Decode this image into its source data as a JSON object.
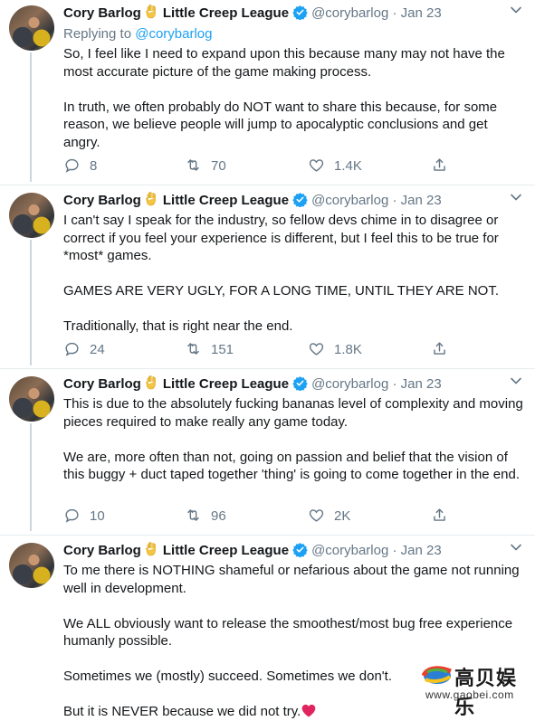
{
  "author": {
    "name": "Cory Barlog",
    "org": "Little Creep League",
    "handle": "@corybarlog",
    "date": "Jan 23"
  },
  "tweets": [
    {
      "reply_to_label": "Replying to",
      "reply_to_handle": "@corybarlog",
      "paragraphs": [
        "So, I feel like I need to expand upon this because many may not have the most accurate picture of the game making process.",
        "In truth, we often probably do NOT want to share this because, for some reason, we believe people will jump to apocalyptic conclusions and get angry."
      ],
      "replies": "8",
      "retweets": "70",
      "likes": "1.4K"
    },
    {
      "paragraphs": [
        "I can't say I speak for the industry, so fellow devs chime in to disagree or correct if you feel your experience is different, but I feel this to be true for *most* games.",
        "GAMES ARE VERY UGLY, FOR A LONG TIME, UNTIL THEY ARE NOT.",
        "Traditionally, that is right near the end."
      ],
      "replies": "24",
      "retweets": "151",
      "likes": "1.8K"
    },
    {
      "paragraphs": [
        "This is due to the absolutely fucking bananas level of complexity and moving pieces required to make really any game today.",
        "We are, more often than not, going on passion and belief that the vision of this buggy + duct taped together 'thing' is going to come together in the end."
      ],
      "replies": "10",
      "retweets": "96",
      "likes": "2K"
    },
    {
      "paragraphs": [
        "To me there is NOTHING shameful or nefarious about the game not running well in development.",
        "We ALL obviously want to release the smoothest/most bug free experience humanly possible.",
        "Sometimes we (mostly) succeed. Sometimes we don't.",
        "But it is NEVER because we did not try."
      ]
    }
  ],
  "watermark": {
    "cn": "高贝娱乐",
    "url": "www.gaobei.com"
  },
  "colors": {
    "link": "#1da1f2",
    "muted": "#657786",
    "verified": "#1da1f2",
    "heart": "#e0245e"
  }
}
